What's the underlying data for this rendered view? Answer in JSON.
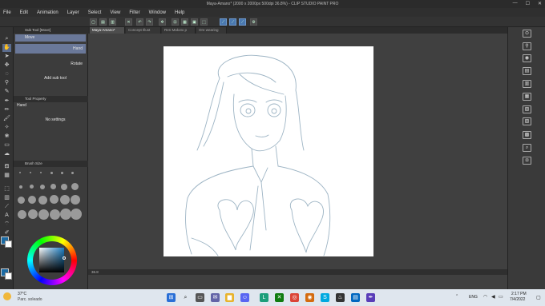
{
  "window": {
    "title": "Maya-Amano* (2000 x 2000px 500dpi 36.8%) - CLIP STUDIO PAINT PRO",
    "controls": [
      "—",
      "☐",
      "✕"
    ]
  },
  "menu": [
    "File",
    "Edit",
    "Animation",
    "Layer",
    "Select",
    "View",
    "Filter",
    "Window",
    "Help"
  ],
  "sub_tool": {
    "header": "Sub Tool [Move]",
    "group": "Move",
    "items": [
      {
        "label": "Hand",
        "selected": true
      },
      {
        "label": "Rotate",
        "selected": false
      }
    ],
    "add_label": "Add sub tool"
  },
  "tool_property": {
    "header": "Tool Property",
    "tool_name": "Hand",
    "body": "No settings"
  },
  "brush_size": {
    "header": "Brush Size"
  },
  "tabs": [
    {
      "label": "Maya-Amano*",
      "active": true
    },
    {
      "label": "Concept Illust",
      "active": false
    },
    {
      "label": "Ren Makoto p",
      "active": false
    },
    {
      "label": "Ore wearing",
      "active": false
    }
  ],
  "status": {
    "zoom": "36.8"
  },
  "color": {
    "main": "#1b6aa3",
    "accent": "#6a7899"
  },
  "taskbar": {
    "weather_temp": "37°C",
    "weather_desc": "Parc. soleado",
    "lang": "ENG",
    "time": "2:17 PM",
    "date": "7/4/2022"
  }
}
